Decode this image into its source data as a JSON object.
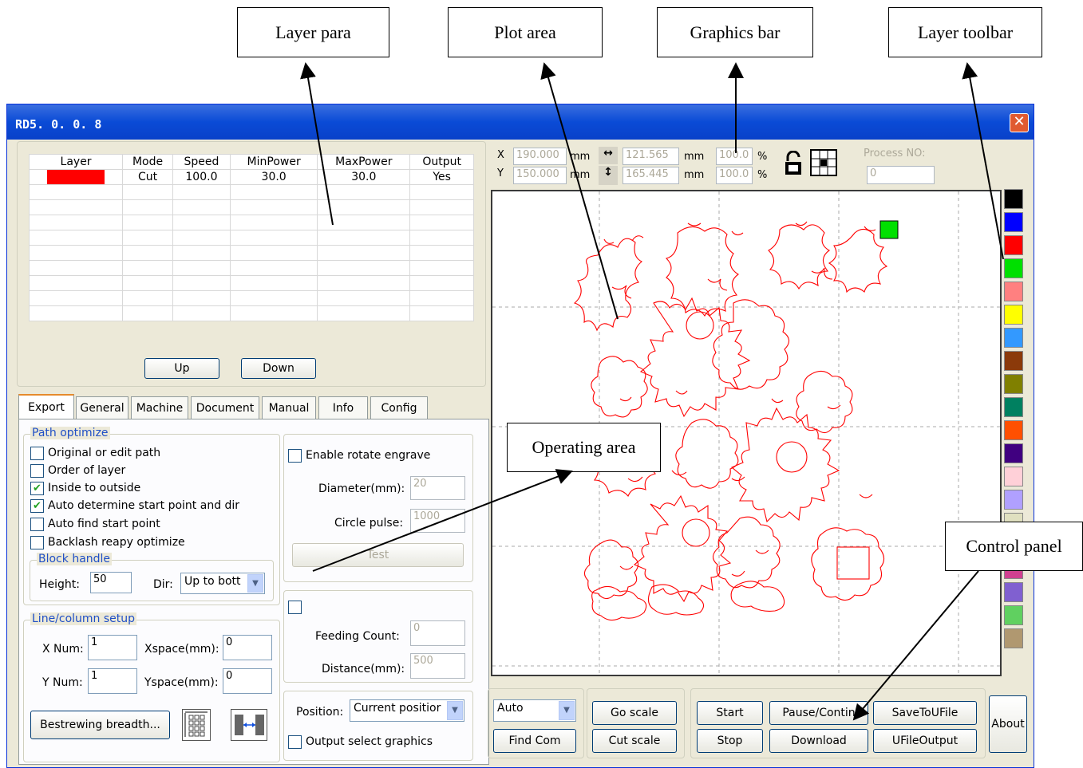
{
  "callouts": {
    "layer_para": "Layer para",
    "plot_area": "Plot area",
    "graphics_bar": "Graphics bar",
    "layer_toolbar": "Layer toolbar",
    "operating_area": "Operating area",
    "control_panel": "Control panel"
  },
  "window": {
    "title": "RD5. 0. 0. 8",
    "close_glyph": "✕"
  },
  "layer_table": {
    "headers": [
      "Layer",
      "Mode",
      "Speed",
      "MinPower",
      "MaxPower",
      "Output"
    ],
    "rows": [
      {
        "color": "#ff0000",
        "mode": "Cut",
        "speed": "100.0",
        "min_power": "30.0",
        "max_power": "30.0",
        "output": "Yes"
      }
    ],
    "up_label": "Up",
    "down_label": "Down"
  },
  "tabs": [
    "Export",
    "General",
    "Machine",
    "Document",
    "Manual",
    "Info",
    "Config"
  ],
  "export": {
    "path_optimize": {
      "legend": "Path optimize",
      "options": [
        {
          "label": "Original or edit path",
          "checked": false
        },
        {
          "label": "Order of layer",
          "checked": false
        },
        {
          "label": "Inside to outside",
          "checked": true
        },
        {
          "label": "Auto determine start point and dir",
          "checked": true
        },
        {
          "label": "Auto find start point",
          "checked": false
        },
        {
          "label": "Backlash reapy optimize",
          "checked": false
        }
      ]
    },
    "block_handle": {
      "legend": "Block handle",
      "height_label": "Height:",
      "height_value": "50",
      "dir_label": "Dir:",
      "dir_value": "Up to bott"
    },
    "rotate": {
      "enable_label": "Enable rotate engrave",
      "diameter_label": "Diameter(mm):",
      "diameter_value": "20",
      "pulse_label": "Circle pulse:",
      "pulse_value": "1000",
      "test_label": "Test"
    },
    "line_column": {
      "legend": "Line/column setup",
      "xnum_label": "X Num:",
      "xnum_value": "1",
      "ynum_label": "Y Num:",
      "ynum_value": "1",
      "xspace_label": "Xspace(mm):",
      "xspace_value": "0",
      "yspace_label": "Yspace(mm):",
      "yspace_value": "0",
      "bestrew_label": "Bestrewing breadth..."
    },
    "feeding": {
      "count_label": "Feeding Count:",
      "count_value": "0",
      "distance_label": "Distance(mm):",
      "distance_value": "500"
    },
    "position": {
      "label": "Position:",
      "value": "Current positior",
      "output_select_label": "Output select graphics"
    }
  },
  "graphics_bar": {
    "x_label": "X",
    "y_label": "Y",
    "x_value": "190.000",
    "y_value": "150.000",
    "unit": "mm",
    "w_value": "121.565",
    "h_value": "165.445",
    "scale_x": "100.0",
    "scale_y": "100.0",
    "percent": "%",
    "process_label": "Process NO:",
    "process_value": "0",
    "h_arrow": "↔",
    "v_arrow": "↕"
  },
  "layer_colors": [
    "#000000",
    "#0000ff",
    "#ff0000",
    "#00e000",
    "#ff8080",
    "#ffff00",
    "#3399ff",
    "#8b3a0a",
    "#808000",
    "#008060",
    "#ff5000",
    "#400080",
    "#ffd0d8",
    "#b0a0ff",
    "#e0e0c0",
    "#60c0a0",
    "#d04090",
    "#8060d0",
    "#60d060",
    "#b09870"
  ],
  "control": {
    "mode_value": "Auto",
    "find_com": "Find Com",
    "go_scale": "Go scale",
    "cut_scale": "Cut scale",
    "start": "Start",
    "pause": "Pause/Contin",
    "save_ufile": "SaveToUFile",
    "stop": "Stop",
    "download": "Download",
    "ufile_output": "UFileOutput",
    "about": "About"
  }
}
